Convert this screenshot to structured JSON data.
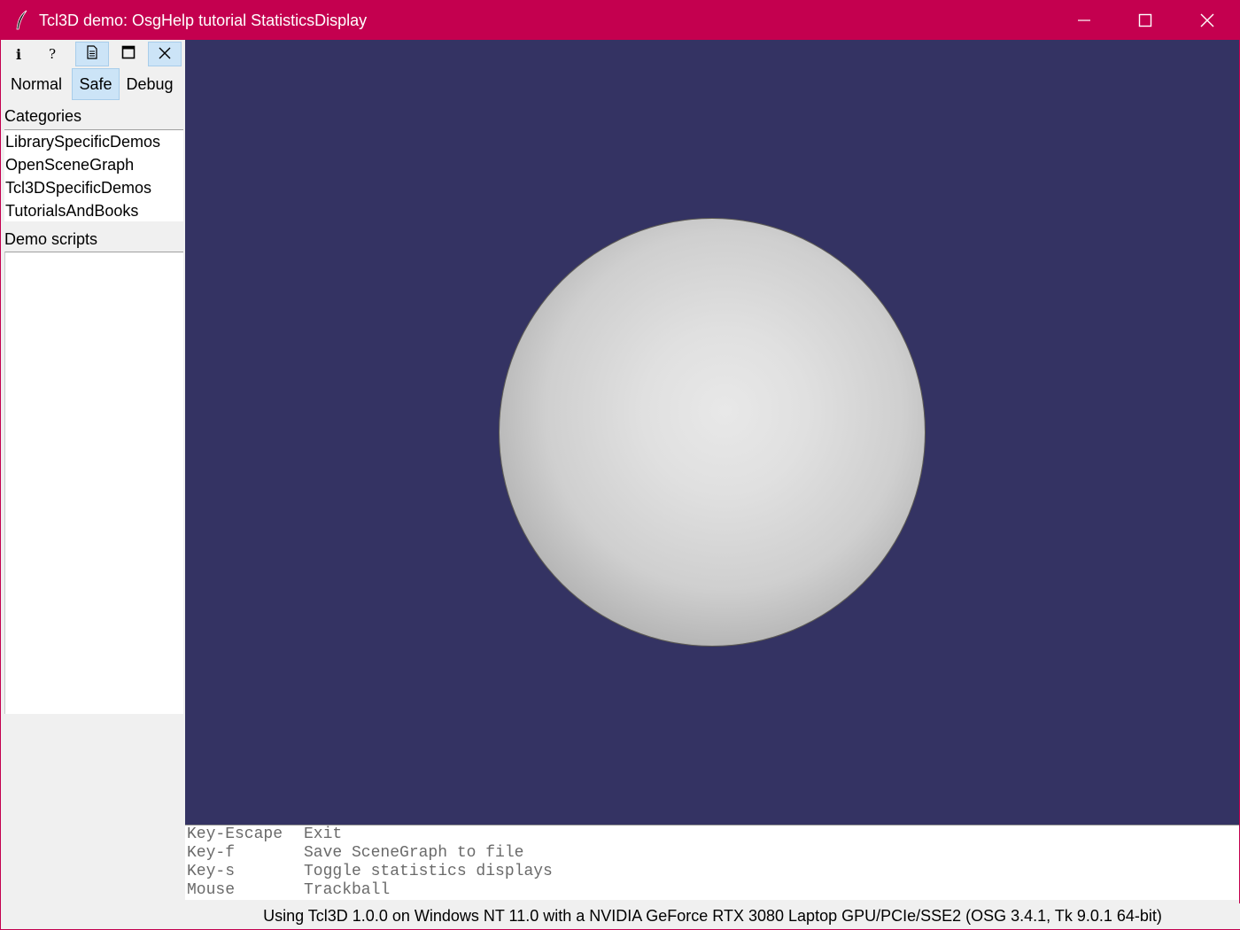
{
  "window": {
    "title": "Tcl3D demo: OsgHelp tutorial StatisticsDisplay",
    "accent_color": "#c4004f"
  },
  "toolbar": {
    "info_glyph": "i",
    "help_glyph": "?",
    "buttons": [
      "info-icon",
      "help-icon",
      "document-icon",
      "window-icon",
      "close-icon"
    ]
  },
  "modes": {
    "normal": "Normal",
    "safe": "Safe",
    "debug": "Debug",
    "selected": "Safe"
  },
  "categories": {
    "label": "Categories",
    "items": [
      "LibrarySpecificDemos",
      "OpenSceneGraph",
      "Tcl3DSpecificDemos",
      "TutorialsAndBooks"
    ]
  },
  "demo_scripts": {
    "label": "Demo scripts",
    "items": []
  },
  "viewport": {
    "background": "#343363",
    "object": "shaded sphere"
  },
  "help": {
    "rows": [
      {
        "key": "Key-Escape",
        "action": "Exit"
      },
      {
        "key": "Key-f",
        "action": "Save SceneGraph to file"
      },
      {
        "key": "Key-s",
        "action": "Toggle statistics displays"
      },
      {
        "key": "Mouse",
        "action": "Trackball"
      }
    ]
  },
  "status": {
    "text": "Using Tcl3D 1.0.0 on Windows NT 11.0 with a NVIDIA GeForce RTX 3080 Laptop GPU/PCIe/SSE2 (OSG 3.4.1, Tk 9.0.1 64-bit)"
  }
}
